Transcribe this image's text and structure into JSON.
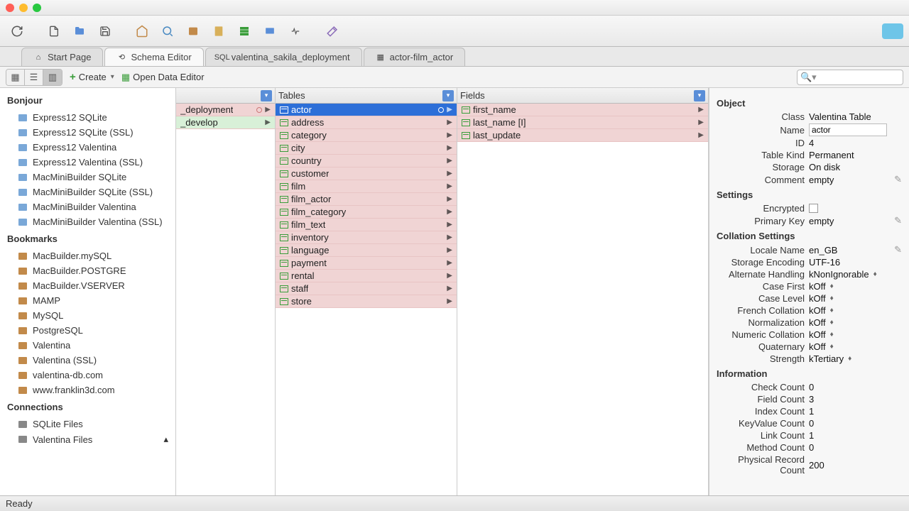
{
  "tabs": [
    {
      "label": "Start Page",
      "icon": "home"
    },
    {
      "label": "Schema Editor",
      "icon": "schema",
      "active": true
    },
    {
      "label": "valentina_sakila_deployment",
      "icon": "sql"
    },
    {
      "label": "actor-film_actor",
      "icon": "table"
    }
  ],
  "subbar": {
    "create": "Create",
    "open": "Open Data Editor",
    "search_ph": ""
  },
  "sidebar": {
    "bonjour": {
      "title": "Bonjour",
      "items": [
        "Express12 SQLite",
        "Express12 SQLite (SSL)",
        "Express12 Valentina",
        "Express12 Valentina (SSL)",
        "MacMiniBuilder SQLite",
        "MacMiniBuilder SQLite (SSL)",
        "MacMiniBuilder Valentina",
        "MacMiniBuilder Valentina (SSL)"
      ]
    },
    "bookmarks": {
      "title": "Bookmarks",
      "items": [
        "MacBuilder.mySQL",
        "MacBuilder.POSTGRE",
        "MacBuilder.VSERVER",
        "MAMP",
        "MySQL",
        "PostgreSQL",
        "Valentina",
        "Valentina (SSL)",
        "valentina-db.com",
        "www.franklin3d.com"
      ]
    },
    "connections": {
      "title": "Connections",
      "items": [
        "SQLite Files",
        "Valentina Files"
      ]
    }
  },
  "colhead": {
    "db": "",
    "tables": "Tables",
    "fields": "Fields"
  },
  "databases": [
    {
      "name": "_deployment",
      "sel": false,
      "dot": true
    },
    {
      "name": "_develop",
      "sel": false,
      "hov": true
    }
  ],
  "tables": [
    "actor",
    "address",
    "category",
    "city",
    "country",
    "customer",
    "film",
    "film_actor",
    "film_category",
    "film_text",
    "inventory",
    "language",
    "payment",
    "rental",
    "staff",
    "store"
  ],
  "table_sel": "actor",
  "fields": [
    {
      "name": "first_name"
    },
    {
      "name": "last_name [I]"
    },
    {
      "name": "last_update"
    }
  ],
  "inspector": {
    "object": {
      "title": "Object",
      "rows": [
        {
          "k": "Class",
          "v": "Valentina Table"
        },
        {
          "k": "Name",
          "v": "actor",
          "editable": true
        },
        {
          "k": "ID",
          "v": "4"
        },
        {
          "k": "Table Kind",
          "v": "Permanent"
        },
        {
          "k": "Storage",
          "v": "On disk"
        },
        {
          "k": "Comment",
          "v": "empty",
          "pencil": true
        }
      ]
    },
    "settings": {
      "title": "Settings",
      "rows": [
        {
          "k": "Encrypted",
          "v": "",
          "check": true
        },
        {
          "k": "Primary Key",
          "v": "empty",
          "pencil": true
        }
      ]
    },
    "collation": {
      "title": "Collation Settings",
      "rows": [
        {
          "k": "Locale Name",
          "v": "en_GB",
          "pencil": true
        },
        {
          "k": "Storage Encoding",
          "v": "UTF-16"
        },
        {
          "k": "Alternate Handling",
          "v": "kNonIgnorable",
          "drop": true
        },
        {
          "k": "Case First",
          "v": "kOff",
          "drop": true
        },
        {
          "k": "Case Level",
          "v": "kOff",
          "drop": true
        },
        {
          "k": "French Collation",
          "v": "kOff",
          "drop": true
        },
        {
          "k": "Normalization",
          "v": "kOff",
          "drop": true
        },
        {
          "k": "Numeric Collation",
          "v": "kOff",
          "drop": true
        },
        {
          "k": "Quaternary",
          "v": "kOff",
          "drop": true
        },
        {
          "k": "Strength",
          "v": "kTertiary",
          "drop": true
        }
      ]
    },
    "info": {
      "title": "Information",
      "rows": [
        {
          "k": "Check Count",
          "v": "0"
        },
        {
          "k": "Field Count",
          "v": "3"
        },
        {
          "k": "Index Count",
          "v": "1"
        },
        {
          "k": "KeyValue Count",
          "v": "0"
        },
        {
          "k": "Link Count",
          "v": "1"
        },
        {
          "k": "Method Count",
          "v": "0"
        },
        {
          "k": "Physical Record Count",
          "v": "200"
        }
      ]
    }
  },
  "status": "Ready"
}
